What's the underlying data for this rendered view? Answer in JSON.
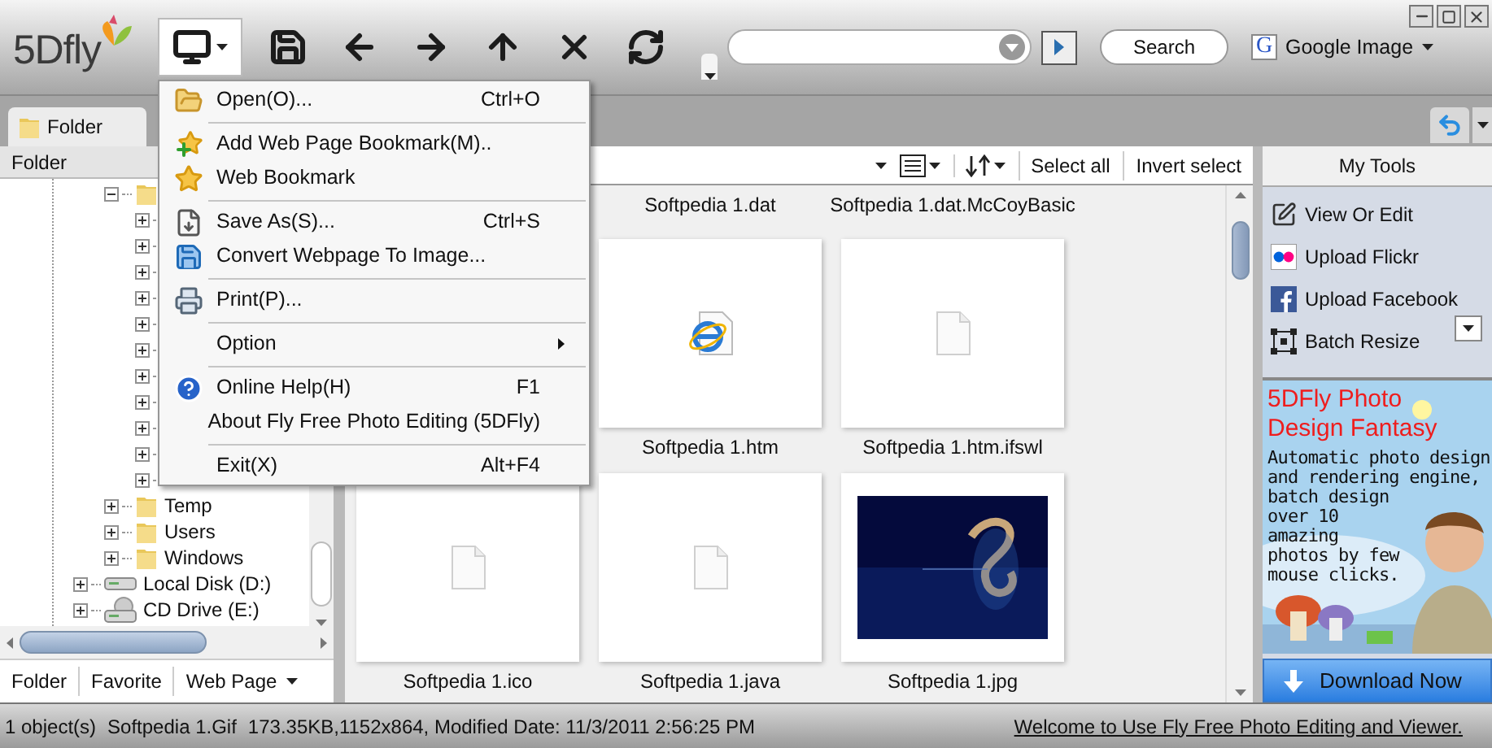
{
  "app": {
    "logo": "5Dfly"
  },
  "toolbar": {
    "buttons": [
      {
        "kind": "monitor",
        "pressed": true,
        "dropdown": true
      },
      {
        "kind": "save",
        "pressed": false
      },
      {
        "kind": "back",
        "pressed": false
      },
      {
        "kind": "forward",
        "pressed": false
      },
      {
        "kind": "up",
        "pressed": false
      },
      {
        "kind": "stop",
        "pressed": false
      },
      {
        "kind": "refresh",
        "pressed": false
      }
    ],
    "search_button": "Search",
    "engine_logo": "G",
    "search_engine": "Google Image"
  },
  "tabs": [
    {
      "label": "Folder",
      "selected": true
    }
  ],
  "left_panel": {
    "header": "Folder",
    "tree": [
      {
        "kind": "folder",
        "expanded": true,
        "children": [
          {
            "expanded": false
          },
          {
            "expanded": false
          },
          {
            "expanded": false
          },
          {
            "expanded": false
          },
          {
            "expanded": false
          },
          {
            "expanded": false
          },
          {
            "expanded": false
          },
          {
            "expanded": false
          },
          {
            "expanded": false
          },
          {
            "expanded": false
          },
          {
            "expanded": false
          }
        ]
      },
      {
        "kind": "folder",
        "label": "Temp",
        "expanded": false
      },
      {
        "kind": "folder",
        "label": "Users",
        "expanded": false
      },
      {
        "kind": "folder",
        "label": "Windows",
        "expanded": false
      }
    ],
    "drives": [
      {
        "kind": "disk",
        "label": "Local Disk (D:)",
        "expanded": false
      },
      {
        "kind": "cd",
        "label": "CD Drive (E:)",
        "expanded": false
      }
    ],
    "tabs": [
      {
        "label": "Folder",
        "dropdown": false
      },
      {
        "label": "Favorite",
        "dropdown": false
      },
      {
        "label": "Web Page",
        "dropdown": true
      }
    ]
  },
  "file_toolbar": {
    "buttons": [
      "Select all",
      "Invert select"
    ]
  },
  "files": [
    [
      {
        "kind": "label_only"
      },
      {
        "kind": "label_only",
        "label": "Softpedia 1.dat"
      },
      {
        "kind": "label_only",
        "label": "Softpedia 1.dat.McCoyBasic"
      }
    ],
    [
      {
        "kind": "covered"
      },
      {
        "kind": "web",
        "label": "Softpedia 1.htm"
      },
      {
        "kind": "document",
        "label": "Softpedia 1.htm.ifswl"
      }
    ],
    [
      {
        "kind": "document",
        "label": "Softpedia 1.ico"
      },
      {
        "kind": "document",
        "label": "Softpedia 1.java"
      },
      {
        "kind": "picture",
        "label": "Softpedia 1.jpg"
      }
    ]
  ],
  "tools_panel": {
    "title": "My Tools",
    "items": [
      {
        "kind": "edit",
        "label": "View Or Edit"
      },
      {
        "kind": "flickr",
        "label": "Upload Flickr"
      },
      {
        "kind": "facebook",
        "label": "Upload Facebook"
      },
      {
        "kind": "resize",
        "label": "Batch Resize"
      }
    ]
  },
  "ad": {
    "title_lines": [
      "5DFly Photo",
      "Design Fantasy"
    ],
    "text_lines": [
      "Automatic photo design",
      "and rendering engine,",
      "batch design",
      "over 10",
      "amazing",
      "photos by few",
      "mouse clicks."
    ],
    "button": "Download Now"
  },
  "menu": {
    "items": [
      {
        "kind": "open",
        "label": "Open(O)...",
        "shortcut": "Ctrl+O"
      },
      {
        "kind": "separator"
      },
      {
        "kind": "add_bookmark",
        "label": "Add Web Page Bookmark(M).."
      },
      {
        "kind": "bookmark",
        "label": "Web Bookmark"
      },
      {
        "kind": "separator"
      },
      {
        "kind": "save_as",
        "label": "Save As(S)...",
        "shortcut": "Ctrl+S"
      },
      {
        "kind": "save",
        "label": "Convert Webpage To Image..."
      },
      {
        "kind": "separator"
      },
      {
        "kind": "print",
        "label": "Print(P)..."
      },
      {
        "kind": "separator"
      },
      {
        "kind": "submenu",
        "label": "Option"
      },
      {
        "kind": "separator"
      },
      {
        "kind": "help",
        "label": "Online Help(H)",
        "shortcut": "F1"
      },
      {
        "kind": "plain",
        "label": "About Fly Free Photo Editing (5DFly)"
      },
      {
        "kind": "separator"
      },
      {
        "kind": "plain",
        "label": "Exit(X)",
        "shortcut": "Alt+F4"
      }
    ]
  },
  "status_bar": {
    "count": "1 object(s)",
    "file": "Softpedia 1.Gif",
    "details": "173.35KB,1152x864, Modified Date: 11/3/2011 2:56:25 PM",
    "link": "Welcome to Use Fly Free Photo Editing and Viewer."
  }
}
